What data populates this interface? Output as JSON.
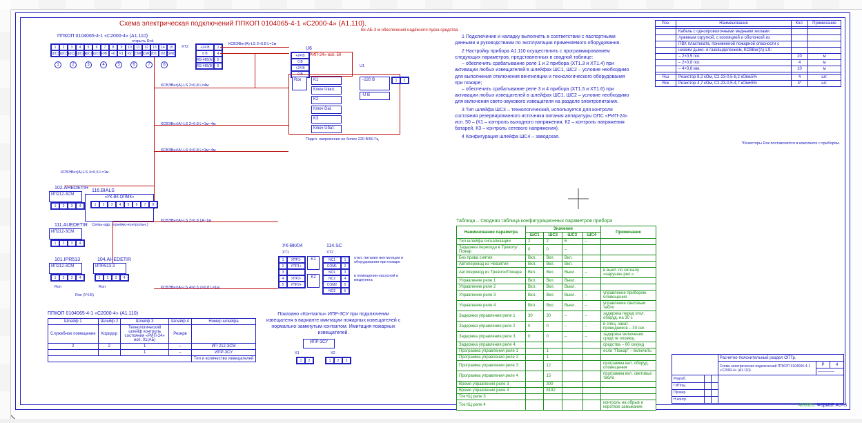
{
  "sheet": {
    "title": "Схема электрическая подключений ППКОП 0104065-4-1 «С2000-4» (А1.110).",
    "top_note": "Вх-АБ-3 м обеспечения надёжного пуска средства",
    "main_device": {
      "label": "ППКОП 0104065-4-1 «С2000-4» (А1.110)",
      "sub": "открыть Rok",
      "xt1_label": "XT1",
      "xt2_label": "XT2",
      "groups": [
        "ШС3",
        "ШС2",
        "ШС1",
        "ШС1",
        "ШС2",
        "ШС3"
      ],
      "term_nums": [
        "1",
        "2",
        "3",
        "4",
        "5",
        "6",
        "7",
        "8",
        "9",
        "10",
        "11",
        "12",
        "13",
        "14",
        "15"
      ],
      "term_nums2": [
        "1",
        "2",
        "3",
        "4",
        "5",
        "6",
        "7",
        "8",
        "9",
        "10"
      ],
      "right_labels": [
        "+24 В",
        "0 В",
        "RS-485(A)",
        "RS-485(B)",
        "K1",
        "K2",
        "CMC1",
        "CMC2",
        "OUT1",
        "OUT2"
      ],
      "circles": [
        "1",
        "2",
        "3",
        "4",
        "5",
        "6",
        "7",
        "8"
      ]
    },
    "wires": {
      "w1": "КСВЭВнг(А)-LS 2×0,8 L=1м",
      "w2": "КСВЭВнг(А)-LS 2×0,8 L=4м",
      "w3": "КСВЭВнг(А)-LS 2×0,8 L=1м~4м",
      "w4": "КСВЭВнг(А)-LS 4×0,8 L=1м~4м",
      "w5": "КСВЭВнг(А)-LS 4×0,5 L=1м",
      "w6": "КСВЭВнг(А)-LS 2×0,8  1A~1м",
      "w7": "КСВЭВнг(А)-LS 4×0,5 2×0,8 L=1м"
    },
    "rip": {
      "label": "«РИП-24» исп. 50",
      "ref": "U6",
      "terms": [
        "+24 В",
        "0 В",
        "+24 В",
        "0 В"
      ]
    },
    "ukvk": {
      "label": "УК-ВК/04",
      "ref": "114.SC",
      "xt1": "XT1",
      "xt2": "XT2",
      "rows": [
        "УПР1-",
        "УПР1+",
        "УПР2-",
        "УПР2+"
      ],
      "outs": [
        "NC1",
        "COM1",
        "NO1",
        "NC2",
        "COM2",
        "NO2"
      ],
      "nums": [
        "1",
        "2",
        "3",
        "4",
        "5",
        "6"
      ],
      "note": "откл. питания вентиляции и оборудования при пожаре",
      "note2": "в помещении насосной и медпункта",
      "k1": "K1",
      "k2": "K2"
    },
    "bials": {
      "ref": "116.BIALS",
      "label": "«УК-ВК ОПМК»",
      "submod": "Связь-адр. (приёмо-контрольн.)",
      "terms": [
        "1",
        "2",
        "3",
        "4",
        "5",
        "6",
        "7",
        "8"
      ]
    },
    "ipr_detectors": {
      "box1_ref": "102.AHEDETIR",
      "box1_model": "ИП212-3СМ",
      "box2_ref": "111.AUEDETIR",
      "box2_model": "ИП212-3СМ",
      "box3_ref": "101.IPR513",
      "box3_model": "ИП212-3СМ",
      "ipr_ref": "104.AHEDETIR",
      "ipr_model": "ИПR513-3",
      "terms": [
        "1",
        "2",
        "3",
        "4"
      ],
      "x1": "X1",
      "x2": "X2",
      "rok_labels": [
        "Ron",
        "Ron"
      ],
      "rok_f": "Rок (УЧ.Б)"
    },
    "ipr3su": {
      "ref": "ИПР-3СУ",
      "note": "Показано «Контакты» ИПР-3СУ при подключении извещателя в варианте имитации пожарных извещателей с нормально-замкнутым контактом. Имитация пожарных извещателей.",
      "terms_x1": "X1",
      "terms_x2": "X2",
      "terms_nums": [
        "1",
        "2",
        "3"
      ]
    },
    "relay_block": {
      "ref": "U6",
      "u1": "U1",
      "k1": "K1",
      "k2": "K2",
      "kluch_ubkl": "Ключ Uвкл.",
      "kluch_dal": "Ключ Dal.",
      "kluch_ubat": "Ключ Uбат.",
      "u1_terms_label": "~220 В",
      "u1_terms": [
        "1",
        "2"
      ],
      "r_label": "-U B",
      "note": "Подкл. напряжения не более 220 В/50 Гц"
    },
    "lower_table": {
      "title": "ППКОП 0104065-4-1 «С2000-4» (А1.110)",
      "headers": [
        "Шлейф 1",
        "Шлейф 2",
        "Шлейф 3",
        "Шлейф 4",
        "Номер шлейфа"
      ],
      "rows": [
        [
          "Служебное помещение",
          "Коридор",
          "Технологический шлейф контроль состояния «РИП-24» исп. 01(АБ)",
          "Резерв",
          ""
        ],
        [
          "2",
          "2",
          "1",
          "–",
          "ИП 212-3СМ"
        ],
        [
          "",
          "",
          "1",
          "–",
          "ИПР-3СУ"
        ],
        [
          "",
          "",
          "",
          "",
          "Тип и количество извещателей"
        ]
      ]
    }
  },
  "notes_right": [
    "1 Подключение и наладку выполнять в соответствии с паспортными данными и руководствами по эксплуатации применяемого оборудования.",
    "2 Настройку прибора А1.110 осуществлять с программированием следующих параметров, представленных в сводной таблице:",
    "– обеспечить срабатывание реле 1 и 2 прибора (XT1.3 и XT1.4) при активации любых извещателей в шлейфах ШС1, ШС2 – условие необходимо для выполнения отключения вентиляции и технологического оборудования при пожаре;",
    "– обеспечить срабатывание реле 3 и 4 прибора (XT1.5 и XT1.6) при активации любых извещателей в шлейфах ШС1, ШС2 – условие необходимо для включения свето-звукового извещателя на разделе электропитания.",
    "3 Тип шлейфа ШС3 – технологический, используется для контроля состояния резервированного источника питания аппаратуры ОПС «РИП-24» исп. 50 – (К1 – контроль выходного напряжения, К2 – контроль напряжения батарей, К3 – контроль сетевого напряжения).",
    "4 Конфигурация шлейфа ШС4 – заводская."
  ],
  "bom": {
    "headers": [
      "Поз.",
      "Наименование",
      "Кол.",
      "Примечание"
    ],
    "rows": [
      [
        "",
        "Кабель с однопроволочными медными жилами",
        "",
        " "
      ],
      [
        "",
        "луженым скруткой, с изоляцией и оболочкой из",
        "",
        " "
      ],
      [
        "",
        "ПВХ пластиката, пониженной пожарной опасности с",
        "",
        " "
      ],
      [
        "",
        "низким дымо- и газовыделением, КСВВнг(А)-LS:",
        "",
        " "
      ],
      [
        "",
        "– 2×0,5 пог.",
        "20",
        "м"
      ],
      [
        "",
        "– 2×0,8 пог.",
        "4",
        "м"
      ],
      [
        "",
        "– 4×0,8 мм.",
        "10",
        "м"
      ],
      [
        "",
        "",
        "",
        ""
      ],
      [
        "Rш",
        "Резистор 8,2 кОм, С2-23-0,5-8,2 кОм±5%",
        "4",
        "шт."
      ],
      [
        "Rок",
        "Резистор 4,7 кОм, С2-23-0,5-4,7 кОм±5%",
        "4*",
        "шт."
      ]
    ],
    "footnote": "*Резисторы Rок поставляются в комплекте с прибором."
  },
  "config_table": {
    "title": "Таблица – Сводная таблица конфигурационных параметров прибора",
    "headers": [
      "Наименование параметра",
      "ШС1",
      "ШС2",
      "ШС3",
      "ШС4",
      "Примечание"
    ],
    "sub_header": "Значение",
    "rows": [
      [
        "Тип шлейфа сигнализации",
        "2",
        "2",
        "6",
        "–",
        ""
      ],
      [
        "Задержка перехода в Тревогу/Пожар",
        "0",
        "0",
        "–",
        "",
        ""
      ],
      [
        "Без права снятия",
        "Вкл.",
        "Вкл.",
        "Вкл.",
        "",
        ""
      ],
      [
        "Автоперевод из Невзятия",
        "Вкл.",
        "Вкл.",
        "Вкл.",
        "",
        ""
      ],
      [
        "Автоперевод из Тревоги/Пожара",
        "Вкл.",
        "Вкл.",
        "Выкл.",
        "–",
        "в выкл. по сигналу «нарушен рел.»"
      ],
      [
        "Управление реле 1",
        "Вкл.",
        "Вкл.",
        "Выкл.",
        "",
        ""
      ],
      [
        "Управление реле 2",
        "Вкл.",
        "Вкл.",
        "Выкл.",
        "",
        ""
      ],
      [
        "Управление реле 3",
        "Вкл.",
        "Вкл.",
        "Выкл.",
        "–",
        "управление прибором оповещения"
      ],
      [
        "Управление реле 4",
        "Вкл.",
        "Вкл.",
        "Выкл.",
        "–",
        "управление световым табло"
      ],
      [
        "Задержка управления реле 1",
        "30",
        "30",
        "–",
        "–",
        "задержка перед откл. оборуд. на 30 с"
      ],
      [
        "Задержка управления реле 2",
        "0",
        "0",
        "–",
        "–",
        "в спец. закат. проводников – 30 сек"
      ],
      [
        "Задержка управления реле 3",
        "0",
        "0",
        "–",
        "–",
        "задержка включения средств оповещ."
      ],
      [
        "Задержка управления реле 4",
        "",
        "",
        "",
        "",
        "средства – 60 секунд"
      ],
      [
        "Программа управления реле 1",
        "",
        "1",
        "",
        "",
        "если \"Пожар\" – включить"
      ],
      [
        "Программа управления реле 2",
        "",
        "1",
        "",
        "",
        ""
      ],
      [
        "Программа управления реле 3",
        "",
        "12",
        "",
        "",
        "программа вкл. оборуд. оповещения"
      ],
      [
        "Программа управления реле 4",
        "",
        "15",
        "",
        "",
        "программа вкл. световых табло"
      ],
      [
        "Время управления реле 3",
        "",
        "300",
        "",
        "",
        ""
      ],
      [
        "Время управления реле 4",
        "",
        "8192",
        "",
        "",
        ""
      ],
      [
        "Ток КЦ реле 3",
        "",
        "",
        "",
        "",
        ""
      ],
      [
        "Ток КЦ реле 4",
        "",
        "",
        "",
        "",
        "контроль на обрыв и короткое замыкание"
      ]
    ]
  },
  "stamp": {
    "proj_line1": "Расчетно-пояснительный раздел ОПТр.",
    "proj_line2": "Схема электрическая подключений ППКОП 0104065-4-1 «С2000-4» (А1.110).",
    "sheet_lbl": "Лист №",
    "stage": "Р",
    "sheet_no": "4",
    "format": "Формат A3×3",
    "roles": [
      "Разраб.",
      "ГИПлщ.",
      "Провер.",
      "Н.контр."
    ],
    "company": "————"
  },
  "status": "4268B1",
  "status2": "Формат A3×3"
}
